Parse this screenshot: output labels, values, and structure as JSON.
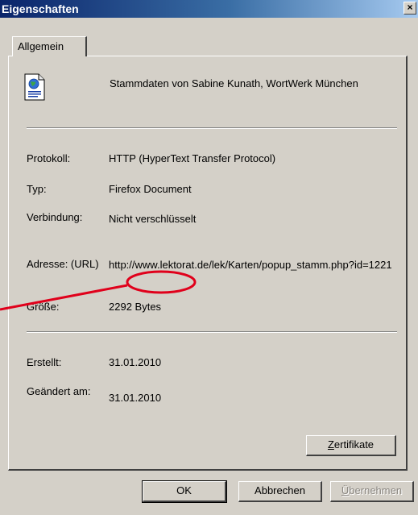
{
  "window": {
    "title": "Eigenschaften",
    "close_glyph": "×"
  },
  "tabs": [
    {
      "label": "Allgemein",
      "selected": true
    }
  ],
  "document": {
    "icon": "web-document-icon",
    "title": "Stammdaten von Sabine Kunath, WortWerk München"
  },
  "properties": {
    "protocol": {
      "label": "Protokoll:",
      "value": "HTTP (HyperText Transfer Protocol)"
    },
    "type": {
      "label": "Typ:",
      "value": "Firefox Document"
    },
    "connection": {
      "label": "Verbindung:",
      "value": "Nicht verschlüsselt"
    },
    "address": {
      "label": "Adresse: (URL)",
      "value": "http://www.lektorat.de/lek/Karten/popup_stamm.php?id=1221"
    },
    "size": {
      "label": "Größe:",
      "value": "2292 Bytes"
    },
    "created": {
      "label": "Erstellt:",
      "value": "31.01.2010"
    },
    "modified": {
      "label": "Geändert am:",
      "value": "31.01.2010"
    }
  },
  "buttons": {
    "certificates": {
      "mnemonic": "Z",
      "rest": "ertifikate"
    },
    "ok": "OK",
    "cancel": "Abbrechen",
    "apply": {
      "mnemonic": "Ü",
      "rest": "bernehmen",
      "enabled": false
    }
  },
  "colors": {
    "annotation": "#e0001b",
    "titlebar_start": "#0a246a",
    "dialog_face": "#d4d0c8"
  }
}
